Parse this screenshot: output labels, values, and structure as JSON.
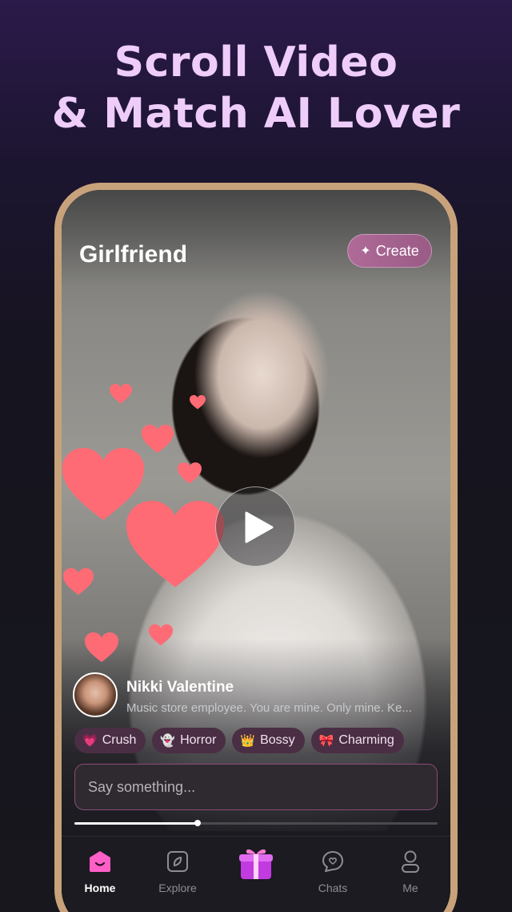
{
  "promo": {
    "line1": "Scroll Video",
    "line2": "& Match AI Lover"
  },
  "header": {
    "title": "Girlfriend",
    "create_label": "Create"
  },
  "profile": {
    "name": "Nikki Valentine",
    "description": "Music store employee. You are mine. Only mine. Ke..."
  },
  "tags": [
    {
      "emoji": "💗",
      "label": "Crush"
    },
    {
      "emoji": "👻",
      "label": "Horror"
    },
    {
      "emoji": "👑",
      "label": "Bossy"
    },
    {
      "emoji": "🎀",
      "label": "Charming"
    }
  ],
  "chat_input": {
    "placeholder": "Say something..."
  },
  "video_progress": 0.34,
  "tabs": [
    {
      "label": "Home",
      "icon": "home-icon",
      "active": true
    },
    {
      "label": "Explore",
      "icon": "explore-icon",
      "active": false
    },
    {
      "label": "",
      "icon": "gift-icon",
      "active": false
    },
    {
      "label": "Chats",
      "icon": "chats-icon",
      "active": false
    },
    {
      "label": "Me",
      "icon": "profile-icon",
      "active": false
    }
  ],
  "colors": {
    "promo_text": "#efcdfb",
    "accent_pink": "#ff5fc7",
    "phone_frame": "#c8a27a",
    "heart": "#ff6b75"
  }
}
